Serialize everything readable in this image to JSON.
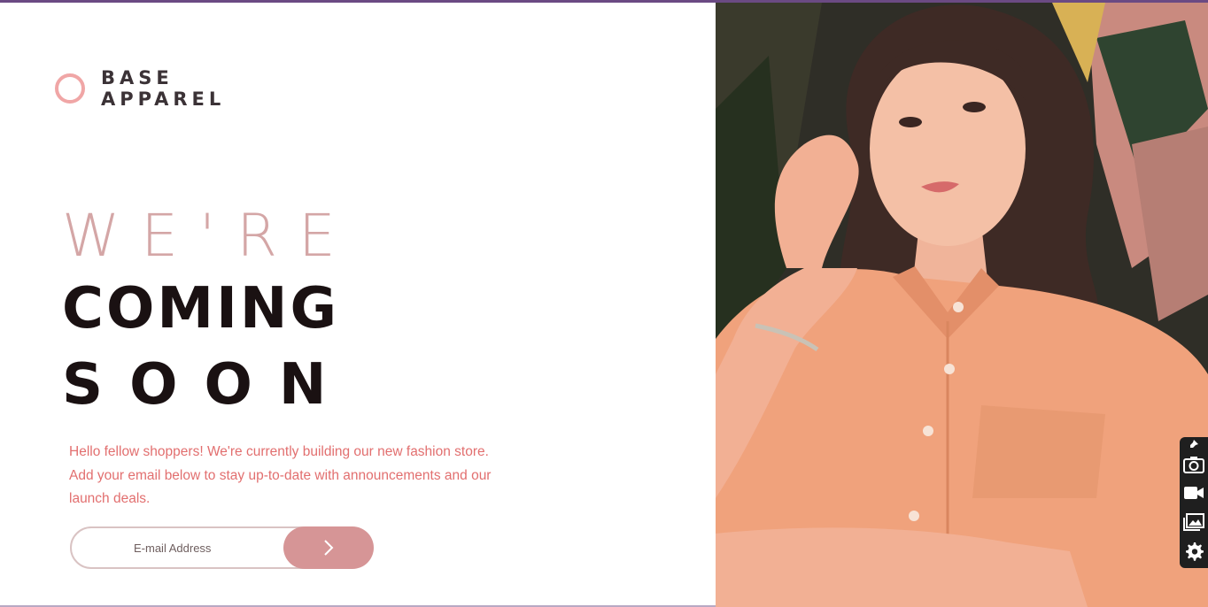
{
  "brand": {
    "line1": "BASE",
    "line2": "APPAREL"
  },
  "hero": {
    "line1": "WE'RE",
    "line2": "COMING",
    "line3": "SOON"
  },
  "description": "Hello fellow shoppers! We're currently building our new fashion store. Add your email below to stay up-to-date with announcements and our launch deals.",
  "form": {
    "email_placeholder": "E-mail Address",
    "submit_icon": "chevron-right-icon"
  },
  "side_toolbar": {
    "icons": [
      "pin-icon",
      "camera-icon",
      "video-icon",
      "image-icon",
      "gear-icon"
    ]
  },
  "colors": {
    "accent_pink": "#d69596",
    "text_pink": "#e26f6f",
    "logo_ring": "#f0a6a6",
    "dark_text": "#1a1112",
    "top_bar": "#6b4a83"
  }
}
